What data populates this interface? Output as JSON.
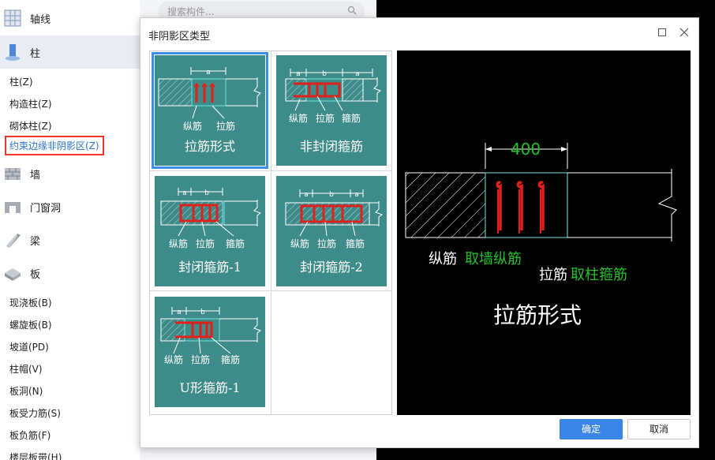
{
  "sidebar": {
    "categories": [
      {
        "label": "轴线",
        "icon": "axis-grid-icon"
      },
      {
        "label": "柱",
        "icon": "column-icon"
      },
      {
        "label": "墙",
        "icon": "wall-icon"
      },
      {
        "label": "门窗洞",
        "icon": "door-window-icon"
      },
      {
        "label": "梁",
        "icon": "beam-icon"
      },
      {
        "label": "板",
        "icon": "slab-icon"
      }
    ],
    "column_items": [
      "柱(Z)",
      "构造柱(Z)",
      "砌体柱(Z)",
      "约束边缘非阴影区(Z)"
    ],
    "slab_items": [
      "现浇板(B)",
      "螺旋板(B)",
      "坡道(PD)",
      "柱帽(V)",
      "板洞(N)",
      "板受力筋(S)",
      "板负筋(F)",
      "楼层板带(H)"
    ]
  },
  "search": {
    "placeholder": "搜索构件..."
  },
  "dialog": {
    "title": "非阴影区类型",
    "ok_label": "确定",
    "cancel_label": "取消",
    "options": [
      {
        "caption": "拉筋形式",
        "selected": true,
        "dims": [
          "a"
        ],
        "labels": [
          "纵筋",
          "拉筋"
        ]
      },
      {
        "caption": "非封闭箍筋",
        "selected": false,
        "dims": [
          "a",
          "b",
          "a"
        ],
        "labels": [
          "纵筋",
          "拉筋",
          "箍筋"
        ]
      },
      {
        "caption": "封闭箍筋-1",
        "selected": false,
        "dims": [
          "a",
          "b"
        ],
        "labels": [
          "纵筋",
          "拉筋",
          "箍筋"
        ]
      },
      {
        "caption": "封闭箍筋-2",
        "selected": false,
        "dims": [
          "a",
          "b",
          "a"
        ],
        "labels": [
          "纵筋",
          "拉筋",
          "箍筋"
        ]
      },
      {
        "caption": "U形箍筋-1",
        "selected": false,
        "dims": [
          "a",
          "b"
        ],
        "labels": [
          "纵筋",
          "拉筋",
          "箍筋"
        ]
      }
    ],
    "preview": {
      "dimension": "400",
      "label1": "纵筋",
      "label1_hint": "取墙纵筋",
      "label2": "拉筋",
      "label2_hint": "取柱箍筋",
      "caption": "拉筋形式"
    }
  },
  "colors": {
    "tile": "#3d8c89",
    "rebar": "#e0201b",
    "hint": "#22c02a",
    "accent": "#3a86e6"
  }
}
